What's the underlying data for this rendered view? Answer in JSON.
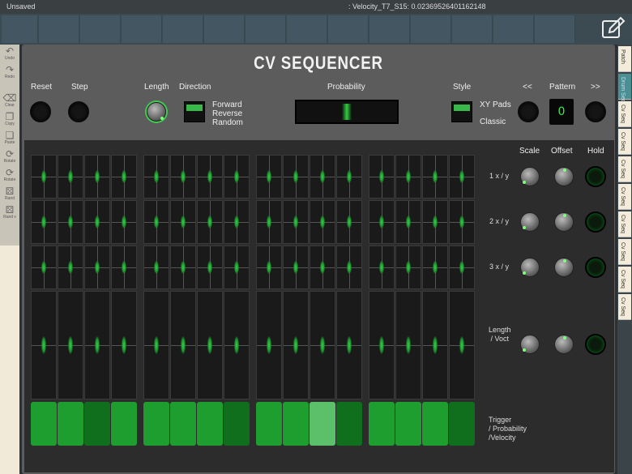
{
  "window": {
    "status_left": "Unsaved",
    "status_center": ": Velocity_T7_S15: 0.02369526401162148"
  },
  "left_tools": [
    {
      "name": "undo",
      "label": "Undo",
      "glyph": "↶"
    },
    {
      "name": "redo",
      "label": "Redo",
      "glyph": "↷"
    },
    {
      "name": "clear",
      "label": "Clear",
      "glyph": "⌫"
    },
    {
      "name": "copy",
      "label": "Copy",
      "glyph": "❐"
    },
    {
      "name": "paste",
      "label": "Paste",
      "glyph": "❏"
    },
    {
      "name": "rotate",
      "label": "Rotate",
      "glyph": "⟳"
    },
    {
      "name": "rotate2",
      "label": "Rotate",
      "glyph": "⟳"
    },
    {
      "name": "rand",
      "label": "Rand",
      "glyph": "⚄"
    },
    {
      "name": "randv",
      "label": "Rand v",
      "glyph": "⚄"
    }
  ],
  "right_tabs": [
    "Patch",
    "Drum Seq",
    "Cv Seq",
    "Cv Seq",
    "Cv Seq",
    "Cv Seq",
    "Cv Seq",
    "Cv Seq",
    "Cv Seq",
    "Cv Seq"
  ],
  "module": {
    "title": "CV SEQUENCER",
    "reset_label": "Reset",
    "step_label": "Step",
    "length_label": "Length",
    "direction_label": "Direction",
    "direction_options": [
      "Forward",
      "Reverse",
      "Random"
    ],
    "probability_label": "Probability",
    "style_label": "Style",
    "style_options": [
      "XY Pads",
      "Classic"
    ],
    "prev_label": "<<",
    "pattern_label": "Pattern",
    "next_label": ">>",
    "pattern_value": "0"
  },
  "side_controls": {
    "scale_label": "Scale",
    "offset_label": "Offset",
    "hold_label": "Hold",
    "rows": [
      "1 x / y",
      "2 x / y",
      "3 x / y",
      "Length\n / Voct"
    ],
    "trigger_label": "Trigger\n/ Probability\n/Velocity"
  },
  "triggers": [
    "#1e9e2e",
    "#1e9e2e",
    "#0f6f1c",
    "#1e9e2e",
    "#1e9e2e",
    "#1e9e2e",
    "#1e9e2e",
    "#0f6f1c",
    "#1e9e2e",
    "#1e9e2e",
    "#5cc06a",
    "#0f6f1c",
    "#1e9e2e",
    "#1e9e2e",
    "#1e9e2e",
    "#0f6f1c"
  ],
  "colors": {
    "accent": "#39b84a",
    "background": "#5c5c5c",
    "panel": "#2c2c2c"
  }
}
